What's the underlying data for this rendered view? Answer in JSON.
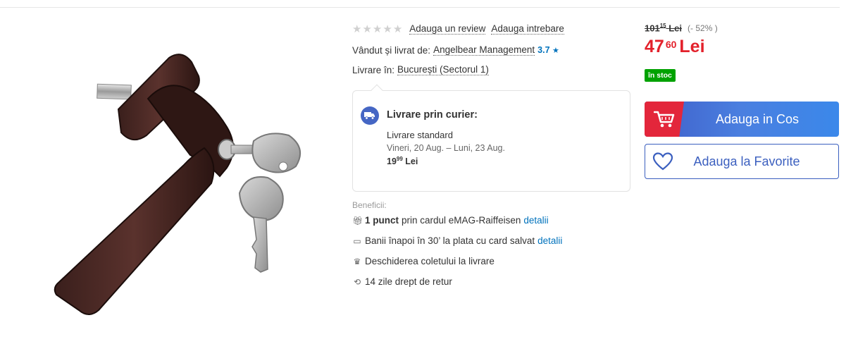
{
  "product": {
    "image_alt": "Maner fereastra maro cu cheie",
    "rating_empty_stars": 5,
    "add_review": "Adauga un review",
    "add_question": "Adauga intrebare",
    "sold_by_label": "Vândut și livrat de:",
    "seller_name": "Angelbear Management",
    "seller_rating": "3.7",
    "delivery_label": "Livrare în:",
    "delivery_location": "București (Sectorul 1)"
  },
  "courier": {
    "title": "Livrare prin curier:",
    "standard_title": "Livrare standard",
    "standard_dates": "Vineri, 20 Aug. – Luni, 23 Aug.",
    "price_main": "19",
    "price_cents": "99",
    "price_currency": "Lei"
  },
  "benefits": {
    "title": "Beneficii:",
    "items": [
      {
        "icon": "gift-icon",
        "bold": "1 punct",
        "text": "prin cardul eMAG-Raiffeisen",
        "link": "detalii"
      },
      {
        "icon": "card-refund-icon",
        "bold": "",
        "text": "Banii înapoi în 30’ la plata cu card salvat",
        "link": "detalii"
      },
      {
        "icon": "box-open-icon",
        "bold": "",
        "text": "Deschiderea coletului la livrare",
        "link": ""
      },
      {
        "icon": "return-icon",
        "bold": "",
        "text": "14 zile drept de retur",
        "link": ""
      }
    ]
  },
  "price": {
    "old_main": "101",
    "old_cents": "15",
    "old_currency": "Lei",
    "discount": "(- 52% )",
    "new_main": "47",
    "new_cents": "60",
    "new_currency": "Lei",
    "stock": "în stoc"
  },
  "actions": {
    "add_to_cart": "Adauga in Cos",
    "add_to_favorites": "Adauga la Favorite"
  },
  "colors": {
    "accent_blue": "#3b5fbf",
    "price_red": "#e3212b",
    "stock_green": "#00a200",
    "cart_red": "#e3263b",
    "link_blue": "#0072bc"
  }
}
